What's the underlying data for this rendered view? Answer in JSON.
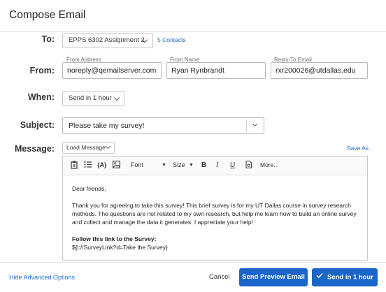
{
  "dialog": {
    "title": "Compose Email"
  },
  "to": {
    "label": "To:",
    "selected": "EPPS 6302 Assignment 2",
    "contacts_link": "5 Contacts"
  },
  "from": {
    "label": "From:",
    "address_label": "From Address",
    "address_value": "noreply@qemailserver.com",
    "name_label": "From Name",
    "name_value": "Ryan Rynbrandt",
    "reply_label": "Reply-To Email",
    "reply_value": "rxr200026@utdallas.edu"
  },
  "when": {
    "label": "When:",
    "selected": "Send in 1 hour"
  },
  "subject": {
    "label": "Subject:",
    "value": "Please take my survey!"
  },
  "message": {
    "label": "Message:",
    "load_label": "Load Message",
    "save_as_label": "Save As",
    "toolbar": {
      "font_label": "Font",
      "size_label": "Size",
      "bold": "B",
      "italic": "I",
      "underline": "U",
      "more_label": "More..."
    },
    "greeting": "Dear friends,",
    "body_paragraph": "Thank you for agreeing to take this survey!  This brief survey is for my UT Dallas course in survey research methods. The questions are not related to my own research, but help me learn how to build an online survey and collect and manage the data it generates.  I appreciate your help!",
    "follow_heading": "Follow this link to the Survey:",
    "survey_link": "${l://SurveyLink?d=Take the Survey}"
  },
  "footer": {
    "hide_advanced": "Hide Advanced Options",
    "cancel": "Cancel",
    "send_preview": "Send Preview Email",
    "send_main": "Send in 1 hour"
  },
  "colors": {
    "accent": "#1a66c8",
    "link": "#1f6fc9"
  }
}
